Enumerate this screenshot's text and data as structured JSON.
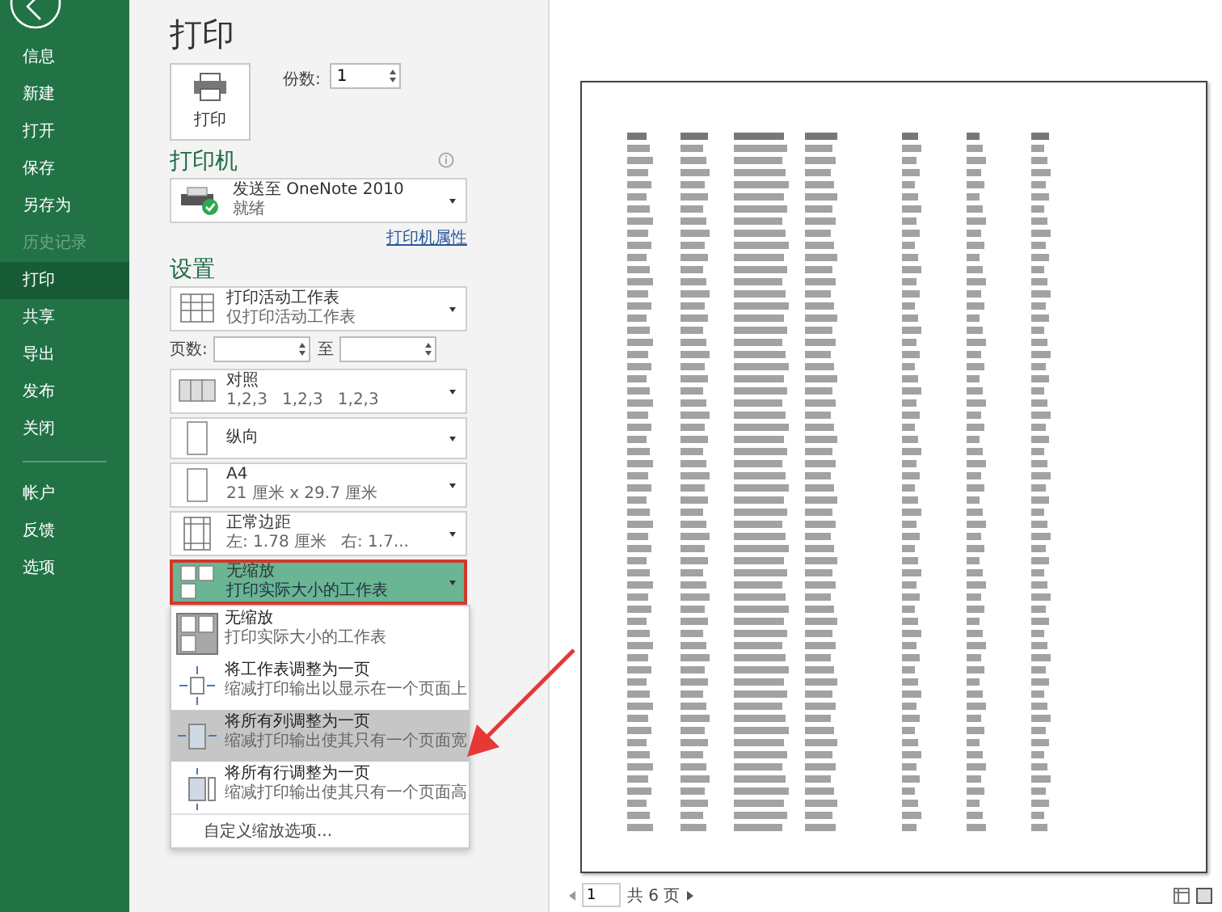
{
  "sidebar": {
    "items": [
      {
        "label": "信息",
        "selected": false,
        "disabled": false
      },
      {
        "label": "新建",
        "selected": false,
        "disabled": false
      },
      {
        "label": "打开",
        "selected": false,
        "disabled": false
      },
      {
        "label": "保存",
        "selected": false,
        "disabled": false
      },
      {
        "label": "另存为",
        "selected": false,
        "disabled": false
      },
      {
        "label": "历史记录",
        "selected": false,
        "disabled": true
      },
      {
        "label": "打印",
        "selected": true,
        "disabled": false
      },
      {
        "label": "共享",
        "selected": false,
        "disabled": false
      },
      {
        "label": "导出",
        "selected": false,
        "disabled": false
      },
      {
        "label": "发布",
        "selected": false,
        "disabled": false
      },
      {
        "label": "关闭",
        "selected": false,
        "disabled": false
      }
    ],
    "footer_items": [
      {
        "label": "帐户",
        "selected": false,
        "disabled": false
      },
      {
        "label": "反馈",
        "selected": false,
        "disabled": false
      },
      {
        "label": "选项",
        "selected": false,
        "disabled": false
      }
    ]
  },
  "print": {
    "title": "打印",
    "button": "打印",
    "copies_label": "份数:",
    "copies": "1"
  },
  "printer": {
    "heading": "打印机",
    "name": "发送至 OneNote 2010",
    "status": "就绪",
    "properties_link": "打印机属性"
  },
  "settings": {
    "heading": "设置",
    "controls": [
      {
        "kind": "dropdown",
        "title": "打印活动工作表",
        "details": [
          "仅打印活动工作表"
        ],
        "selected": false
      },
      {
        "kind": "range",
        "label": "页数:",
        "to": "至"
      },
      {
        "kind": "dropdown",
        "title": "对照",
        "details": [
          "1,2,3",
          "1,2,3",
          "1,2,3"
        ],
        "selected": false
      },
      {
        "kind": "dropdown",
        "title": "纵向",
        "selected": false
      },
      {
        "kind": "dropdown",
        "title": "A4",
        "details": [
          "21 厘米 x 29.7 厘米"
        ],
        "selected": false
      },
      {
        "kind": "dropdown",
        "title": "正常边距",
        "details": [
          "左: 1.78 厘米",
          "右: 1.7..."
        ],
        "selected": false
      },
      {
        "kind": "dropdown",
        "title": "无缩放",
        "details": [
          "打印实际大小的工作表"
        ],
        "selected": true
      }
    ],
    "scaling_menu": {
      "options": [
        {
          "title": "无缩放",
          "description": "打印实际大小的工作表",
          "selected": true,
          "hovered": false
        },
        {
          "title": "将工作表调整为一页",
          "description": "缩减打印输出以显示在一个页面上",
          "selected": false,
          "hovered": false
        },
        {
          "title": "将所有列调整为一页",
          "description": "缩减打印输出使其只有一个页面宽",
          "selected": false,
          "hovered": true
        },
        {
          "title": "将所有行调整为一页",
          "description": "缩减打印输出使其只有一个页面高",
          "selected": false,
          "hovered": false
        }
      ],
      "custom": "自定义缩放选项..."
    }
  },
  "preview": {
    "page_input": "1",
    "page_total": "共 6 页"
  }
}
